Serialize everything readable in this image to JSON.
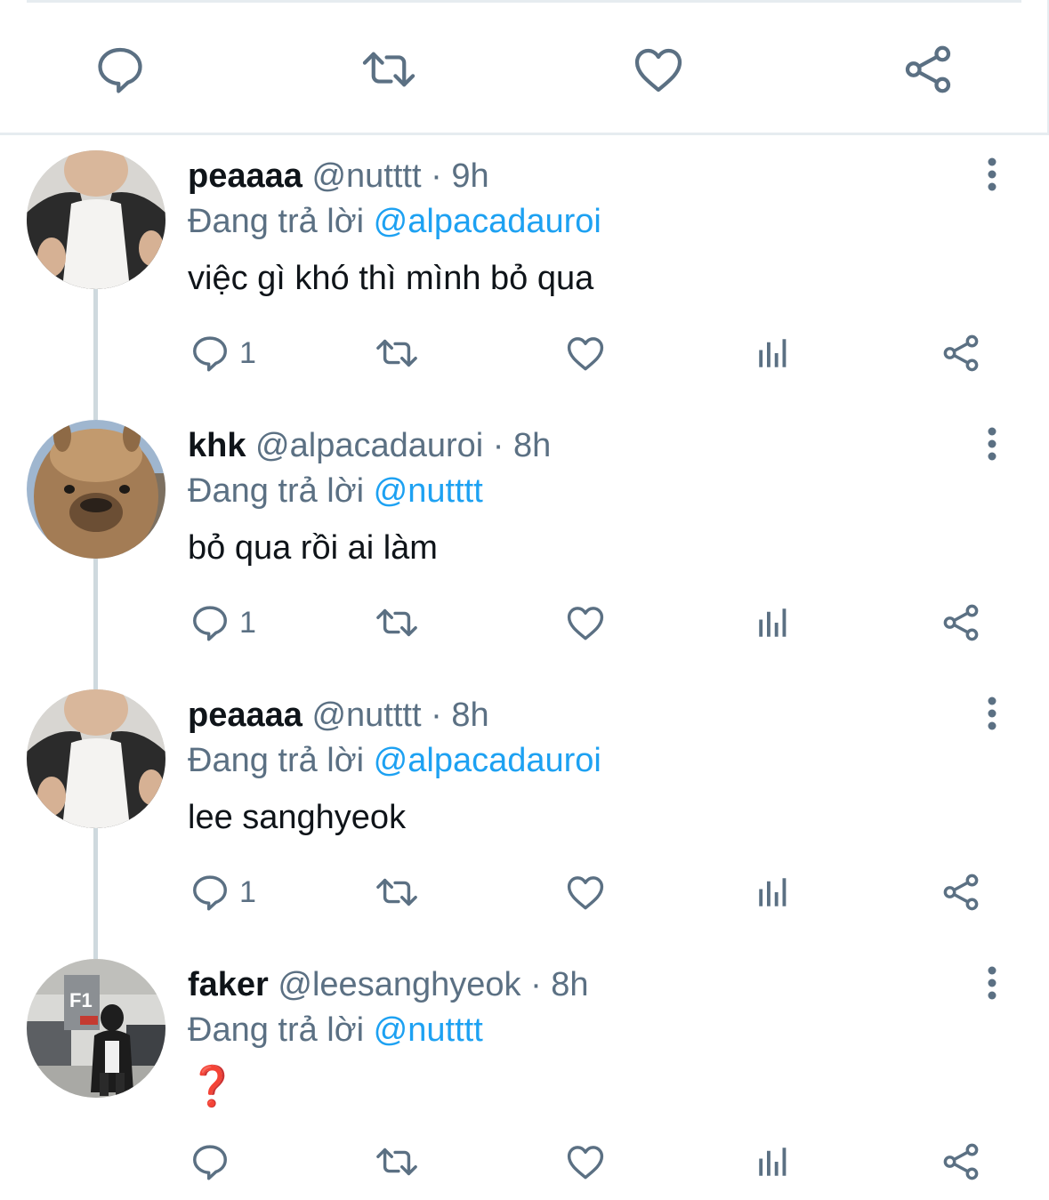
{
  "colors": {
    "icon_gray": "#5b7083",
    "mention_blue": "#1da1f2",
    "thread_line": "#cfd9de",
    "divider": "#e6ecf0",
    "name_text": "#0f1419"
  },
  "main_actions": {
    "icons": [
      "comment-icon",
      "retweet-icon",
      "like-icon",
      "share-icon"
    ]
  },
  "replies": [
    {
      "name": "peaaaa",
      "handle": "@nutttt",
      "separator": "·",
      "time": "9h",
      "reply_prefix": "Đang trả lời",
      "reply_to": "@alpacadauroi",
      "text": "việc gì khó thì mình bỏ qua",
      "reply_count": "1",
      "avatar": "person-in-white-shirt"
    },
    {
      "name": "khk",
      "handle": "@alpacadauroi",
      "separator": "·",
      "time": "8h",
      "reply_prefix": "Đang trả lời",
      "reply_to": "@nutttt",
      "text": "bỏ qua rồi ai làm",
      "reply_count": "1",
      "avatar": "alpaca"
    },
    {
      "name": "peaaaa",
      "handle": "@nutttt",
      "separator": "·",
      "time": "8h",
      "reply_prefix": "Đang trả lời",
      "reply_to": "@alpacadauroi",
      "text": "lee sanghyeok",
      "reply_count": "1",
      "avatar": "person-in-white-shirt"
    },
    {
      "name": "faker",
      "handle": "@leesanghyeok",
      "separator": "·",
      "time": "8h",
      "reply_prefix": "Đang trả lời",
      "reply_to": "@nutttt",
      "text": "❓",
      "reply_count": "",
      "avatar": "person-in-parking-garage",
      "avatar_sign": "F1"
    }
  ]
}
